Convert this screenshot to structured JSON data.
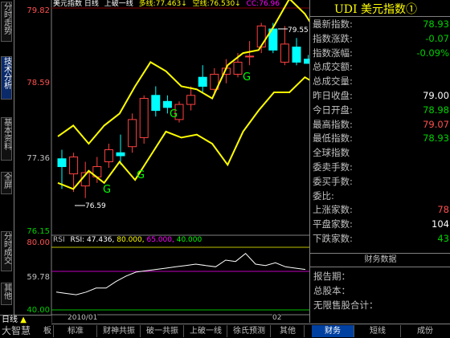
{
  "left_tabs": [
    "分时走势",
    "技术分析",
    "基本资料",
    "全屏",
    "分时成交",
    "其他"
  ],
  "chart": {
    "title": "美元指数",
    "period": "日线",
    "tool": "上破一线",
    "up_label": "多线:",
    "up_value": "77.463↓",
    "down_label": "空线:",
    "down_value": "76.530↓",
    "cc_label": "CC:",
    "cc_value": "76.96",
    "price_ticks": [
      "79.82",
      "78.59",
      "77.36",
      "76.15"
    ],
    "annot_high": "79.55",
    "annot_low": "76.59",
    "date_left": "2010/01",
    "date_right": "02",
    "rsi_header": "RSI",
    "rsi_label": "RSI:",
    "rsi_value": "47.436,",
    "rsi_l1": "80.000,",
    "rsi_l2": "65.000,",
    "rsi_l3": "40.000",
    "rsi_ticks": [
      "80.00",
      "59.78",
      "40.00"
    ]
  },
  "quote": {
    "title": "UDI 美元指数①",
    "rows": [
      {
        "k": "最新指数:",
        "v": "78.93",
        "c": "green"
      },
      {
        "k": "指数涨跌:",
        "v": "-0.07",
        "c": "green"
      },
      {
        "k": "指数涨幅:",
        "v": "-0.09%",
        "c": "green"
      },
      {
        "k": "总成交额:",
        "v": "",
        "c": ""
      },
      {
        "k": "总成交量:",
        "v": "",
        "c": ""
      },
      {
        "k": "昨日收盘:",
        "v": "79.00",
        "c": "white"
      },
      {
        "k": "今日开盘:",
        "v": "78.98",
        "c": "green"
      },
      {
        "k": "最高指数:",
        "v": "79.07",
        "c": "red"
      },
      {
        "k": "最低指数:",
        "v": "78.93",
        "c": "green"
      },
      {
        "k": "全球指数",
        "v": "",
        "c": ""
      },
      {
        "k": "委卖手数:",
        "v": "",
        "c": ""
      },
      {
        "k": "委买手数:",
        "v": "",
        "c": ""
      },
      {
        "k": "委比:",
        "v": "",
        "c": ""
      },
      {
        "k": "上涨家数:",
        "v": "78",
        "c": "red"
      },
      {
        "k": "平盘家数:",
        "v": "104",
        "c": "white"
      },
      {
        "k": "下跌家数:",
        "v": "43",
        "c": "green"
      }
    ],
    "section": "财务数据",
    "fin_rows": [
      "报告期：",
      "总股本：",
      "无限售股合计："
    ]
  },
  "bottom": {
    "brand": "大智慧",
    "period": "日线",
    "tabs": [
      "板",
      "标准",
      "财神共振",
      "破一共振",
      "上破一线",
      "徐氏预测",
      "其他"
    ],
    "right_tabs": [
      "财务",
      "短线",
      "成份"
    ]
  },
  "candles": [
    {
      "o": 77.35,
      "c": 77.22,
      "h": 77.5,
      "l": 76.85
    },
    {
      "o": 77.1,
      "c": 77.38,
      "h": 77.45,
      "l": 76.8
    },
    {
      "o": 76.9,
      "c": 77.12,
      "h": 77.3,
      "l": 76.7
    },
    {
      "o": 77.05,
      "c": 77.22,
      "h": 77.38,
      "l": 76.95
    },
    {
      "o": 77.3,
      "c": 77.5,
      "h": 77.6,
      "l": 77.2
    },
    {
      "o": 77.45,
      "c": 77.4,
      "h": 77.75,
      "l": 77.25
    },
    {
      "o": 77.55,
      "c": 78.0,
      "h": 78.1,
      "l": 77.45
    },
    {
      "o": 77.7,
      "c": 78.35,
      "h": 78.4,
      "l": 77.6
    },
    {
      "o": 78.4,
      "c": 78.15,
      "h": 78.55,
      "l": 78.05
    },
    {
      "o": 78.3,
      "c": 78.2,
      "h": 78.4,
      "l": 78.1
    },
    {
      "o": 78.0,
      "c": 78.25,
      "h": 78.3,
      "l": 77.95
    },
    {
      "o": 78.25,
      "c": 78.4,
      "h": 78.55,
      "l": 78.15
    },
    {
      "o": 78.7,
      "c": 78.55,
      "h": 78.9,
      "l": 78.45
    },
    {
      "o": 78.5,
      "c": 78.75,
      "h": 78.85,
      "l": 78.4
    },
    {
      "o": 78.75,
      "c": 78.85,
      "h": 79.0,
      "l": 78.6
    },
    {
      "o": 78.75,
      "c": 78.95,
      "h": 79.1,
      "l": 78.7
    },
    {
      "o": 79.05,
      "c": 79.05,
      "h": 79.3,
      "l": 78.9
    },
    {
      "o": 79.2,
      "c": 79.55,
      "h": 79.6,
      "l": 79.1
    },
    {
      "o": 79.5,
      "c": 79.15,
      "h": 79.6,
      "l": 79.1
    },
    {
      "o": 78.95,
      "c": 79.25,
      "h": 79.55,
      "l": 78.9
    },
    {
      "o": 79.2,
      "c": 78.95,
      "h": 79.35,
      "l": 78.9
    },
    {
      "o": 79.0,
      "c": 78.93,
      "h": 79.07,
      "l": 78.93
    }
  ],
  "upper_band": [
    77.72,
    77.9,
    77.6,
    77.9,
    78.1,
    78.55,
    78.95,
    78.8,
    78.55,
    78.5,
    78.35,
    78.9,
    79.1,
    79.15,
    79.55,
    80.0,
    79.75,
    79.35
  ],
  "lower_band": [
    76.95,
    76.85,
    77.15,
    76.95,
    77.3,
    77.0,
    77.4,
    77.8,
    77.7,
    77.75,
    77.6,
    77.25,
    77.8,
    78.15,
    78.45,
    78.45,
    78.7,
    78.55
  ],
  "rsi_series": [
    52,
    51,
    50,
    52,
    55,
    55,
    60,
    64,
    67,
    68,
    69,
    70,
    71,
    72,
    73,
    72,
    71,
    76,
    75,
    81,
    73,
    72,
    74,
    71,
    70,
    69
  ]
}
